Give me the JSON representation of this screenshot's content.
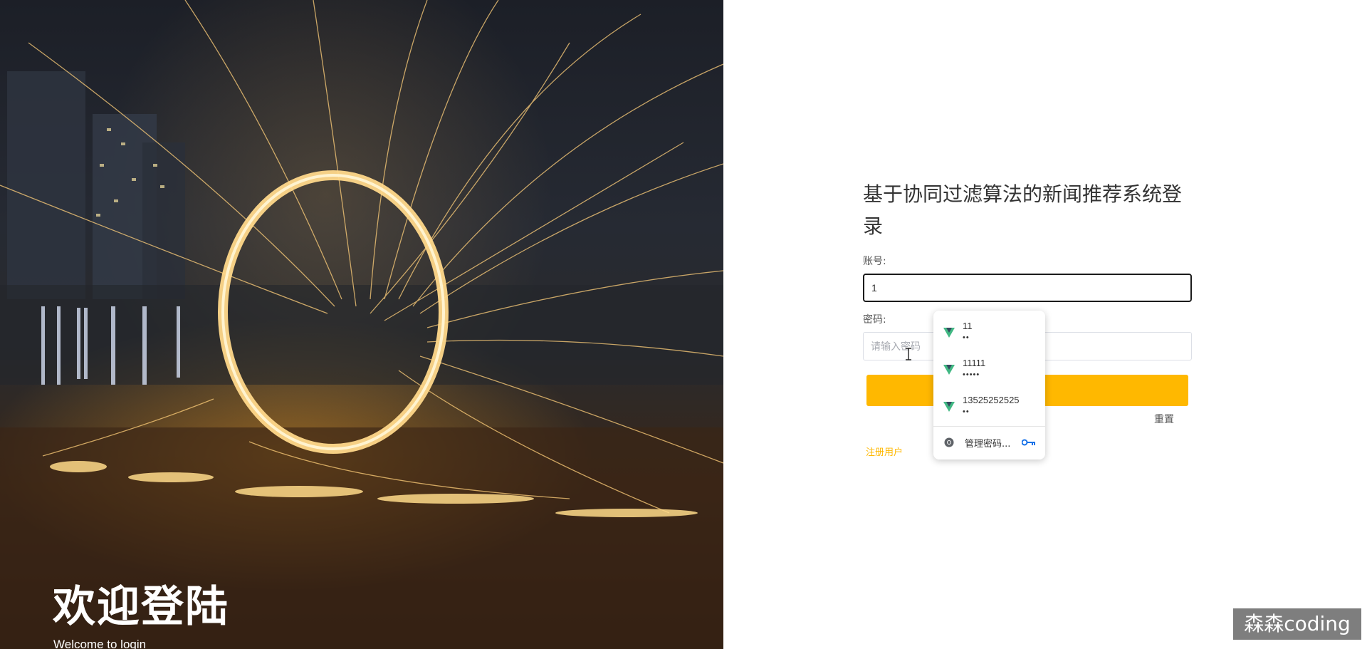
{
  "hero": {
    "title": "欢迎登陆",
    "subtitle": "Welcome to login"
  },
  "login": {
    "title": "基于协同过滤算法的新闻推荐系统登录",
    "account_label": "账号:",
    "account_value": "1",
    "password_label": "密码:",
    "password_placeholder": "请输入密码",
    "login_button": "",
    "reset_button": "重置",
    "register_link": "注册用户"
  },
  "autofill": {
    "items": [
      {
        "username": "11",
        "password": "••"
      },
      {
        "username": "11111",
        "password": "•••••"
      },
      {
        "username": "13525252525",
        "password": "••"
      }
    ],
    "manage_label": "管理密码...",
    "item_icon": "vue-logo-icon",
    "manage_icon": "chrome-icon",
    "key_icon": "key-icon"
  },
  "watermark": "森森coding",
  "colors": {
    "accent": "#ffb800",
    "focus_border": "#1b1b1b",
    "vue_green": "#41b883",
    "vue_dark": "#35495e"
  }
}
